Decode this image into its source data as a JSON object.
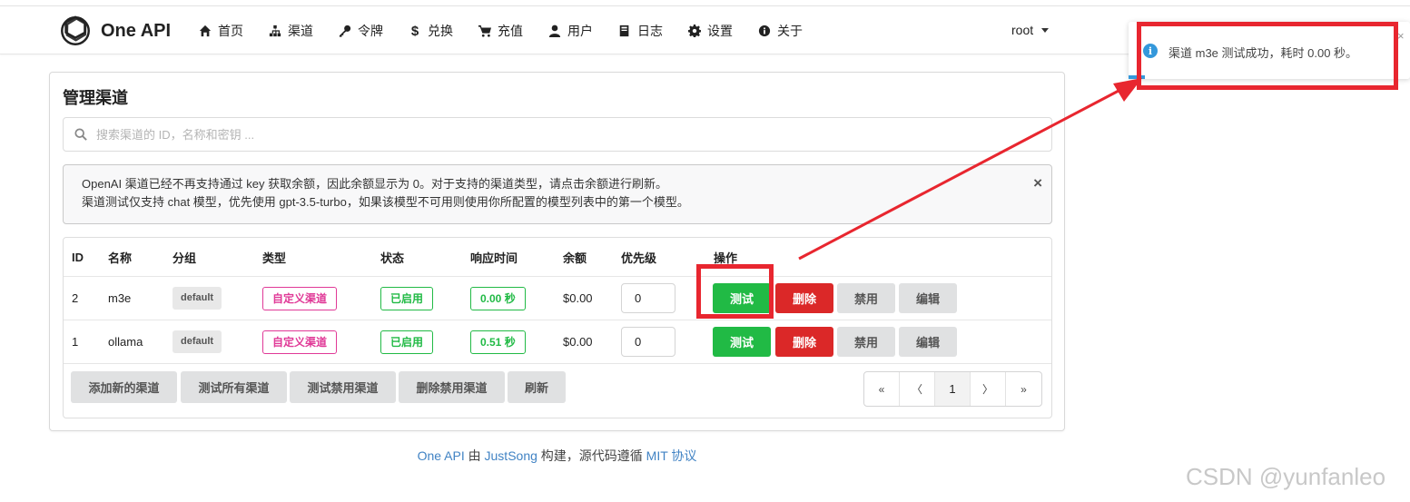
{
  "app": {
    "name": "One API"
  },
  "nav": [
    {
      "label": "首页",
      "icon": "home-icon"
    },
    {
      "label": "渠道",
      "icon": "sitemap-icon"
    },
    {
      "label": "令牌",
      "icon": "key-icon"
    },
    {
      "label": "兑换",
      "icon": "dollar-icon"
    },
    {
      "label": "充值",
      "icon": "cart-icon"
    },
    {
      "label": "用户",
      "icon": "user-icon"
    },
    {
      "label": "日志",
      "icon": "book-icon"
    },
    {
      "label": "设置",
      "icon": "gear-icon"
    },
    {
      "label": "关于",
      "icon": "info-icon"
    }
  ],
  "user": {
    "name": "root"
  },
  "page": {
    "title": "管理渠道",
    "search_placeholder": "搜索渠道的 ID，名称和密钥 ...",
    "notice_line1": "OpenAI 渠道已经不再支持通过 key 获取余额，因此余额显示为 0。对于支持的渠道类型，请点击余额进行刷新。",
    "notice_line2": "渠道测试仅支持 chat 模型，优先使用 gpt-3.5-turbo，如果该模型不可用则使用你所配置的模型列表中的第一个模型。",
    "notice_close": "×"
  },
  "table": {
    "headers": {
      "id": "ID",
      "name": "名称",
      "group": "分组",
      "type": "类型",
      "status": "状态",
      "response": "响应时间",
      "balance": "余额",
      "priority": "优先级",
      "actions": "操作"
    },
    "rows": [
      {
        "id": "2",
        "name": "m3e",
        "group": "default",
        "type": "自定义渠道",
        "status": "已启用",
        "response": "0.00 秒",
        "balance": "$0.00",
        "priority": "0"
      },
      {
        "id": "1",
        "name": "ollama",
        "group": "default",
        "type": "自定义渠道",
        "status": "已启用",
        "response": "0.51 秒",
        "balance": "$0.00",
        "priority": "0"
      }
    ],
    "actions": {
      "test": "测试",
      "delete": "删除",
      "disable": "禁用",
      "edit": "编辑"
    }
  },
  "footer_buttons": {
    "add": "添加新的渠道",
    "test_all": "测试所有渠道",
    "test_disabled": "测试禁用渠道",
    "delete_disabled": "删除禁用渠道",
    "refresh": "刷新"
  },
  "pagination": {
    "first": "«",
    "prev": "〈",
    "current": "1",
    "next": "〉",
    "last": "»"
  },
  "footer": {
    "p1": "One API",
    "p2": " 由 ",
    "p3": "JustSong",
    "p4": " 构建，源代码遵循 ",
    "p5": "MIT 协议"
  },
  "toast": {
    "message": "渠道 m3e 测试成功，耗时 0.00 秒。",
    "icon": "i"
  },
  "watermark": "CSDN @yunfanleo",
  "colors": {
    "annotation": "#e8262f",
    "green": "#21ba45",
    "red": "#db2828",
    "pink": "#e03997",
    "info": "#3498db"
  }
}
